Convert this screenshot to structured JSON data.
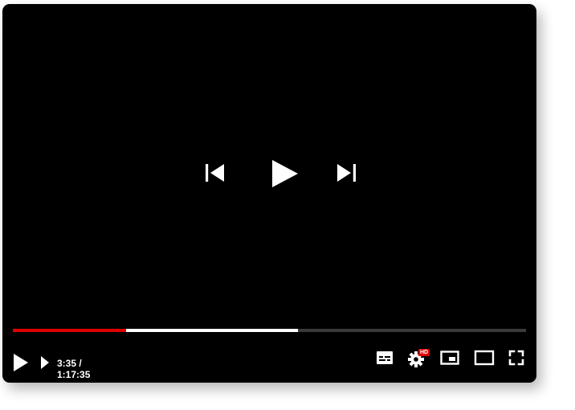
{
  "player": {
    "current_time": "3:35 /",
    "duration": "1:17:35",
    "played_fraction": 0.22,
    "buffered_fraction": 0.555,
    "quality_badge": "HD",
    "colors": {
      "background": "#000000",
      "played": "#e00000",
      "buffered": "#ffffff",
      "track": "#3a3a3a",
      "icon": "#ffffff"
    }
  },
  "icons": {
    "center_prev": "skip-previous-icon",
    "center_play": "play-icon",
    "center_next": "skip-next-icon",
    "bottom_play": "play-icon",
    "bottom_next": "next-icon",
    "subtitles": "subtitles-icon",
    "settings": "settings-gear-icon",
    "miniplayer": "miniplayer-icon",
    "theater": "theater-mode-icon",
    "fullscreen": "fullscreen-icon"
  }
}
